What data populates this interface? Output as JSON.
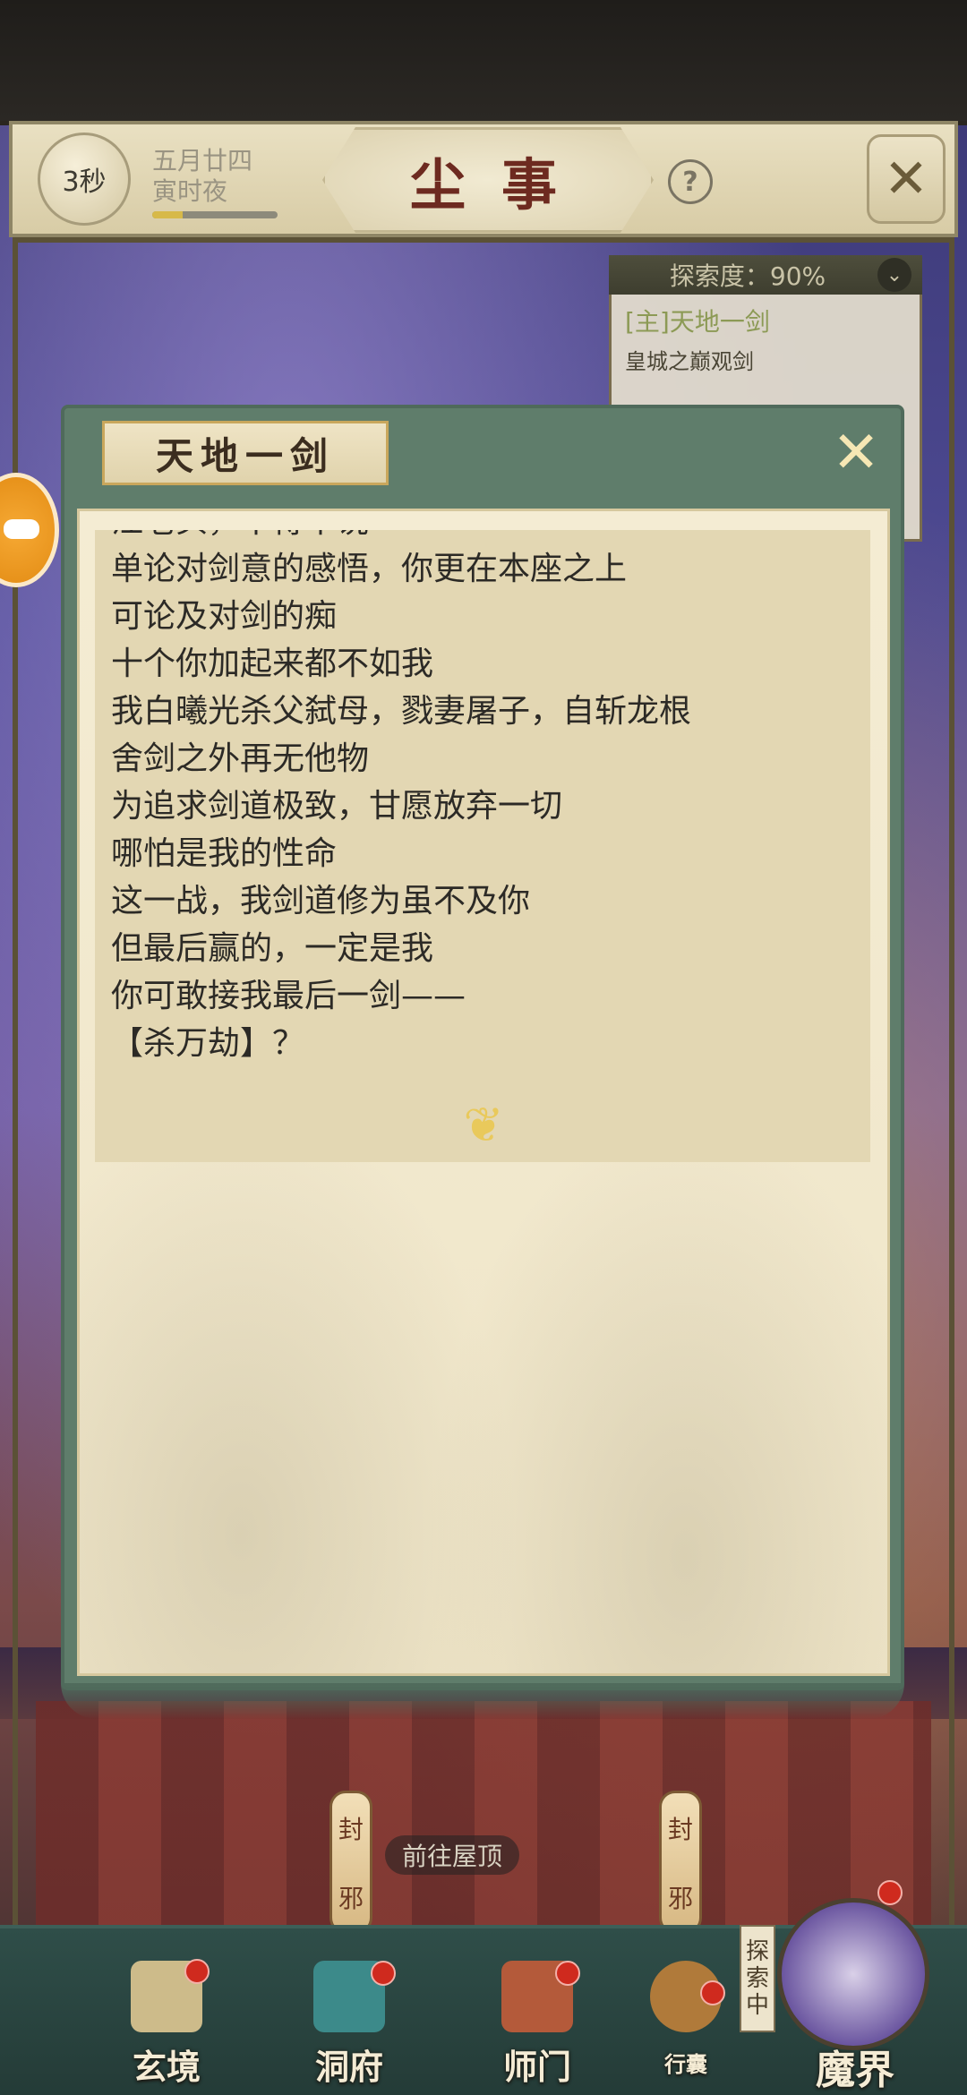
{
  "header": {
    "timer": "3秒",
    "date_line1": "五月廿四",
    "date_line2": "寅时夜",
    "title": "尘事",
    "help": "?",
    "close_icon": "✕"
  },
  "explore": {
    "label": "探索度：90%",
    "toggle_icon": "chevron-down-icon",
    "quest_title": "[主]天地一剑",
    "quest_subtitle": "皇城之巅观剑"
  },
  "dialog": {
    "title": "天地一剑",
    "lines": [
      "江老头，不得不说",
      "单论对剑意的感悟，你更在本座之上",
      "可论及对剑的痴",
      "十个你加起来都不如我",
      "我白曦光杀父弑母，戮妻屠子，自斩龙根",
      "舍剑之外再无他物",
      "为追求剑道极致，甘愿放弃一切",
      "哪怕是我的性命",
      "这一战，我剑道修为虽不及你",
      "但最后赢的，一定是我",
      "你可敢接我最后一剑——",
      "【杀万劫】？"
    ],
    "continue_icon": "ornament-continue-icon"
  },
  "scene": {
    "goto_roof": "前往屋顶",
    "lantern_left": [
      "封",
      "邪"
    ],
    "lantern_right": [
      "封",
      "邪"
    ]
  },
  "nav": {
    "items": [
      {
        "label": "玄境"
      },
      {
        "label": "洞府"
      },
      {
        "label": "师门"
      },
      {
        "label": "行囊"
      }
    ],
    "explore_tag": [
      "探",
      "索",
      "中"
    ],
    "mojie": "魔界"
  },
  "colors": {
    "dialog_frame": "#5f7d6b",
    "title_red": "#6d2a20",
    "text": "#2c2a26",
    "notify_dot": "#cf2a1e"
  }
}
